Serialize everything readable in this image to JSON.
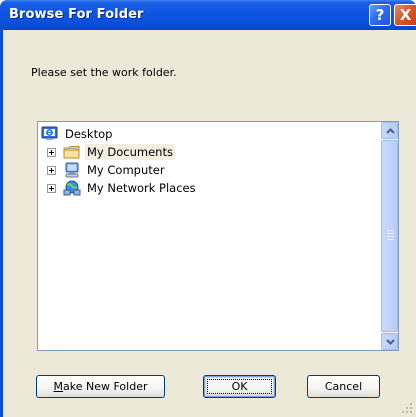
{
  "window": {
    "title": "Browse For Folder",
    "help_glyph": "?",
    "close_glyph": "X"
  },
  "instruction": "Please set the work folder.",
  "tree": {
    "root": {
      "label": "Desktop",
      "icon": "desktop-icon"
    },
    "items": [
      {
        "label": "My Documents",
        "icon": "my-documents-folder-icon",
        "expanded": false,
        "hover": true
      },
      {
        "label": "My Computer",
        "icon": "my-computer-icon",
        "expanded": false,
        "hover": false
      },
      {
        "label": "My Network Places",
        "icon": "network-places-icon",
        "expanded": false,
        "hover": false
      }
    ]
  },
  "buttons": {
    "make_new_folder": {
      "mnemonic": "M",
      "rest": "ake New Folder"
    },
    "ok": "OK",
    "cancel": "Cancel"
  },
  "colors": {
    "titlebar": "#0a4fd8",
    "dialog_face": "#ece9d8",
    "tree_border": "#7f9db9",
    "button_border": "#003c74"
  }
}
